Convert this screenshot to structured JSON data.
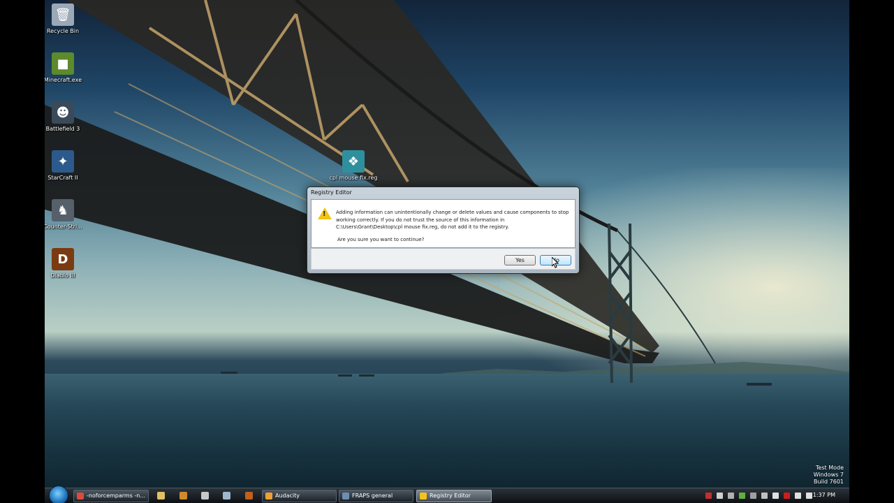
{
  "desktop": {
    "icons": [
      {
        "label": "Recycle Bin",
        "icon": "recycle-bin-icon",
        "color": "#9aa9b5",
        "glyph": "🗑"
      },
      {
        "label": "Minecraft.exe",
        "icon": "minecraft-icon",
        "color": "#5c8a2c",
        "glyph": "■"
      },
      {
        "label": "Battlefield 3",
        "icon": "battlefield-3-icon",
        "color": "#3a4a5a",
        "glyph": "☻"
      },
      {
        "label": "StarCraft II",
        "icon": "starcraft-ii-icon",
        "color": "#2c5a8c",
        "glyph": "✦"
      },
      {
        "label": "Counter-Stri...",
        "icon": "counter-strike-icon",
        "color": "#55606a",
        "glyph": "♞"
      },
      {
        "label": "Diablo III",
        "icon": "diablo-iii-icon",
        "color": "#7a3b12",
        "glyph": "D"
      },
      {
        "label": "cpl mouse fix.reg",
        "icon": "registry-file-icon",
        "color": "#2f8f9d",
        "glyph": "❖"
      }
    ]
  },
  "dialog": {
    "title": "Registry Editor",
    "message": "Adding information can unintentionally change or delete values and cause components to stop working correctly. If you do not trust the source of this information in C:\\Users\\Grant\\Desktop\\cpl mouse fix.reg, do not add it to the registry.",
    "question": "Are you sure you want to continue?",
    "yes_label": "Yes",
    "no_label": "No",
    "warning_icon": "warning-icon"
  },
  "watermark": {
    "line1": "Test Mode",
    "line2": "Windows 7",
    "line3": "Build 7601"
  },
  "taskbar": {
    "start_icon": "windows-start-orb-icon",
    "quick_launch": [
      {
        "icon": "explorer-icon",
        "color": "#e0c060"
      },
      {
        "icon": "tool-icon",
        "color": "#d08a2a"
      },
      {
        "icon": "steam-icon",
        "color": "#c8c8c8"
      },
      {
        "icon": "starcraft-icon",
        "color": "#9fb7cc"
      },
      {
        "icon": "diablo-icon",
        "color": "#c2601c"
      }
    ],
    "tasks": [
      {
        "label": "-noforcemparms -n...",
        "icon": "chrome-icon",
        "color": "#d94c3a",
        "active": false
      },
      {
        "label": "Audacity",
        "icon": "audacity-icon",
        "color": "#f0a030",
        "active": false
      },
      {
        "label": "FRAPS general",
        "icon": "fraps-icon",
        "color": "#6a8fb0",
        "active": false
      },
      {
        "label": "Registry Editor",
        "icon": "warning-icon",
        "color": "#f2c31a",
        "active": true
      }
    ],
    "tray_icons": [
      {
        "icon": "tray-app-icon",
        "color": "#c03030"
      },
      {
        "icon": "tray-fraps-icon",
        "color": "#d0d0d0"
      },
      {
        "icon": "tray-steam-icon",
        "color": "#b0b0b0"
      },
      {
        "icon": "tray-utorrent-icon",
        "color": "#60b040"
      },
      {
        "icon": "tray-app2-icon",
        "color": "#a0a0a0"
      },
      {
        "icon": "tray-app3-icon",
        "color": "#c0c0c0"
      },
      {
        "icon": "tray-flag-icon",
        "color": "#e0e0e0"
      },
      {
        "icon": "tray-antivirus-icon",
        "color": "#c82020"
      },
      {
        "icon": "tray-network-icon",
        "color": "#e0e0e0"
      },
      {
        "icon": "tray-volume-icon",
        "color": "#e0e0e0"
      }
    ],
    "clock": "1:37 PM"
  }
}
